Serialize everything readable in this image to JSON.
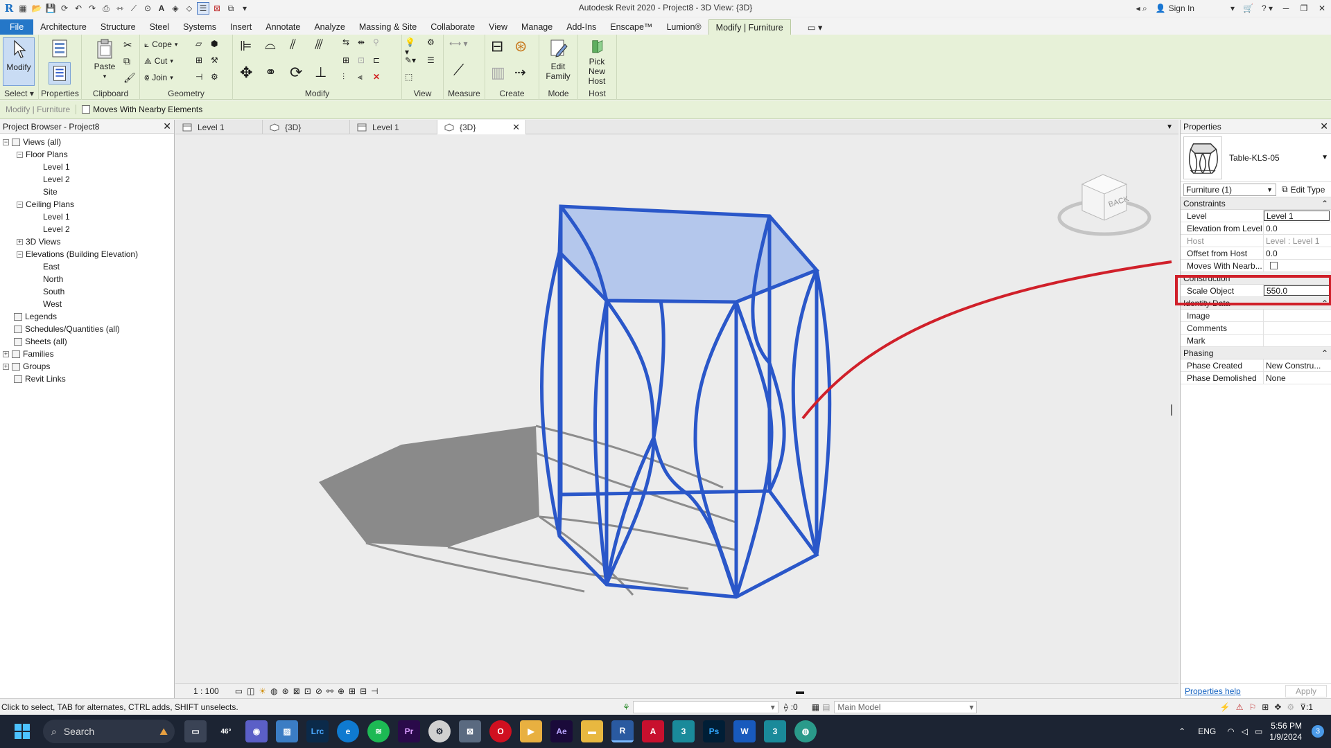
{
  "window": {
    "title": "Autodesk Revit 2020 - Project8 - 3D View: {3D}",
    "sign_in": "Sign In"
  },
  "ribbon_tabs": [
    "File",
    "Architecture",
    "Structure",
    "Steel",
    "Systems",
    "Insert",
    "Annotate",
    "Analyze",
    "Massing & Site",
    "Collaborate",
    "View",
    "Manage",
    "Add-Ins",
    "Enscape™",
    "Lumion®",
    "Modify | Furniture"
  ],
  "ribbon": {
    "select": {
      "modify": "Modify",
      "label": "Select"
    },
    "properties": {
      "button": "Properties",
      "label": "Properties"
    },
    "clipboard": {
      "paste": "Paste",
      "label": "Clipboard"
    },
    "geometry": {
      "cope": "Cope",
      "cut": "Cut",
      "join": "Join",
      "label": "Geometry"
    },
    "modify": {
      "label": "Modify"
    },
    "view": {
      "label": "View"
    },
    "measure": {
      "label": "Measure"
    },
    "create": {
      "label": "Create"
    },
    "mode": {
      "button_line1": "Edit",
      "button_line2": "Family",
      "label": "Mode"
    },
    "host": {
      "button_line1": "Pick",
      "button_line2": "New Host",
      "label": "Host"
    }
  },
  "options_bar": {
    "context": "Modify | Furniture",
    "moves_with_nearby": "Moves With Nearby Elements"
  },
  "project_browser": {
    "title": "Project Browser - Project8",
    "nodes": [
      {
        "label": "Views (all)",
        "level": 0,
        "toggle": "−"
      },
      {
        "label": "Floor Plans",
        "level": 1,
        "toggle": "−"
      },
      {
        "label": "Level 1",
        "level": 2
      },
      {
        "label": "Level 2",
        "level": 2
      },
      {
        "label": "Site",
        "level": 2
      },
      {
        "label": "Ceiling Plans",
        "level": 1,
        "toggle": "−"
      },
      {
        "label": "Level 1",
        "level": 2
      },
      {
        "label": "Level 2",
        "level": 2
      },
      {
        "label": "3D Views",
        "level": 1,
        "toggle": "+"
      },
      {
        "label": "Elevations (Building Elevation)",
        "level": 1,
        "toggle": "−"
      },
      {
        "label": "East",
        "level": 2
      },
      {
        "label": "North",
        "level": 2
      },
      {
        "label": "South",
        "level": 2
      },
      {
        "label": "West",
        "level": 2
      },
      {
        "label": "Legends",
        "level": 0
      },
      {
        "label": "Schedules/Quantities (all)",
        "level": 0
      },
      {
        "label": "Sheets (all)",
        "level": 0
      },
      {
        "label": "Families",
        "level": 0,
        "toggle": "+"
      },
      {
        "label": "Groups",
        "level": 0,
        "toggle": "+"
      },
      {
        "label": "Revit Links",
        "level": 0
      }
    ]
  },
  "view_tabs": [
    {
      "label": "Level 1",
      "active": false
    },
    {
      "label": "{3D}",
      "active": false
    },
    {
      "label": "Level 1",
      "active": false
    },
    {
      "label": "{3D}",
      "active": true
    }
  ],
  "viewcube": {
    "face": "BACK"
  },
  "view_control": {
    "scale": "1 : 100"
  },
  "properties": {
    "title": "Properties",
    "type_name": "Table-KLS-05",
    "instance_selector": "Furniture (1)",
    "edit_type": "Edit Type",
    "groups": [
      {
        "name": "Constraints",
        "rows": [
          {
            "name": "Level",
            "value": "Level 1",
            "edit": true
          },
          {
            "name": "Elevation from Level",
            "value": "0.0"
          },
          {
            "name": "Host",
            "value": "Level : Level 1",
            "dim": true
          },
          {
            "name": "Offset from Host",
            "value": "0.0"
          },
          {
            "name": "Moves With Nearb...",
            "value": "",
            "checkbox": true
          }
        ]
      },
      {
        "name": "Construction",
        "rows": [
          {
            "name": "Scale Object",
            "value": "550.0",
            "edit": true
          }
        ]
      },
      {
        "name": "Identity Data",
        "rows": [
          {
            "name": "Image",
            "value": ""
          },
          {
            "name": "Comments",
            "value": ""
          },
          {
            "name": "Mark",
            "value": ""
          }
        ]
      },
      {
        "name": "Phasing",
        "rows": [
          {
            "name": "Phase Created",
            "value": "New Constru..."
          },
          {
            "name": "Phase Demolished",
            "value": "None"
          }
        ]
      }
    ],
    "help_link": "Properties help",
    "apply": "Apply"
  },
  "status_bar": {
    "hint": "Click to select, TAB for alternates, CTRL adds, SHIFT unselects.",
    "worksets": ":0",
    "model": "Main Model",
    "filter": ":1"
  },
  "taskbar": {
    "search": "Search",
    "weather": "46°",
    "language": "ENG",
    "time": "5:56 PM",
    "date": "1/9/2024",
    "notifications": "3"
  },
  "colors": {
    "ribbon_bg": "#e7f1d8",
    "file_tab": "#2577c8",
    "selection_blue": "#2a57c9",
    "annotation_red": "#d0202a"
  }
}
